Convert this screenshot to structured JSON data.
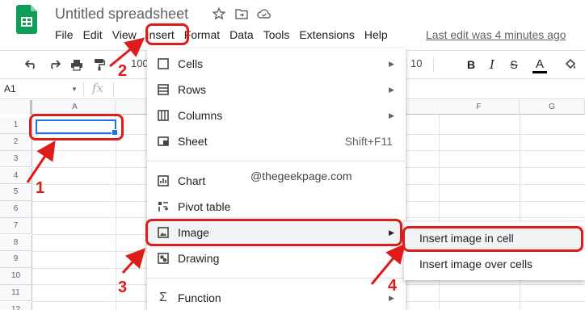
{
  "app": {
    "title": "Untitled spreadsheet",
    "last_edit": "Last edit was 4 minutes ago"
  },
  "menubar": [
    "File",
    "Edit",
    "View",
    "Insert",
    "Format",
    "Data",
    "Tools",
    "Extensions",
    "Help"
  ],
  "toolbar": {
    "zoom_partial": "100",
    "font_size": "10"
  },
  "formula_bar": {
    "name_box": "A1",
    "fx": "fx"
  },
  "grid": {
    "columns": [
      "A",
      "F",
      "G"
    ],
    "rows": [
      "1",
      "2",
      "3",
      "4",
      "5",
      "6",
      "7",
      "8",
      "9",
      "10",
      "11",
      "12"
    ]
  },
  "insert_menu": {
    "items": [
      {
        "label": "Cells",
        "icon": "cells-icon",
        "has_submenu": true
      },
      {
        "label": "Rows",
        "icon": "rows-icon",
        "has_submenu": true
      },
      {
        "label": "Columns",
        "icon": "columns-icon",
        "has_submenu": true
      },
      {
        "label": "Sheet",
        "icon": "sheet-icon",
        "shortcut": "Shift+F11"
      },
      {
        "label": "Chart",
        "icon": "chart-icon"
      },
      {
        "label": "Pivot table",
        "icon": "pivot-table-icon"
      },
      {
        "label": "Image",
        "icon": "image-icon",
        "has_submenu": true,
        "highlighted": true
      },
      {
        "label": "Drawing",
        "icon": "drawing-icon"
      },
      {
        "label": "Function",
        "icon": "function-icon",
        "has_submenu": true
      }
    ]
  },
  "image_submenu": {
    "items": [
      "Insert image in cell",
      "Insert image over cells"
    ]
  },
  "watermark": "@thegeekpage.com",
  "annotations": {
    "step_numbers": [
      "1",
      "2",
      "3",
      "4"
    ],
    "color": "#e01b1b"
  },
  "colors": {
    "sheets_green": "#0f9d58",
    "selection_blue": "#1a73e8"
  }
}
